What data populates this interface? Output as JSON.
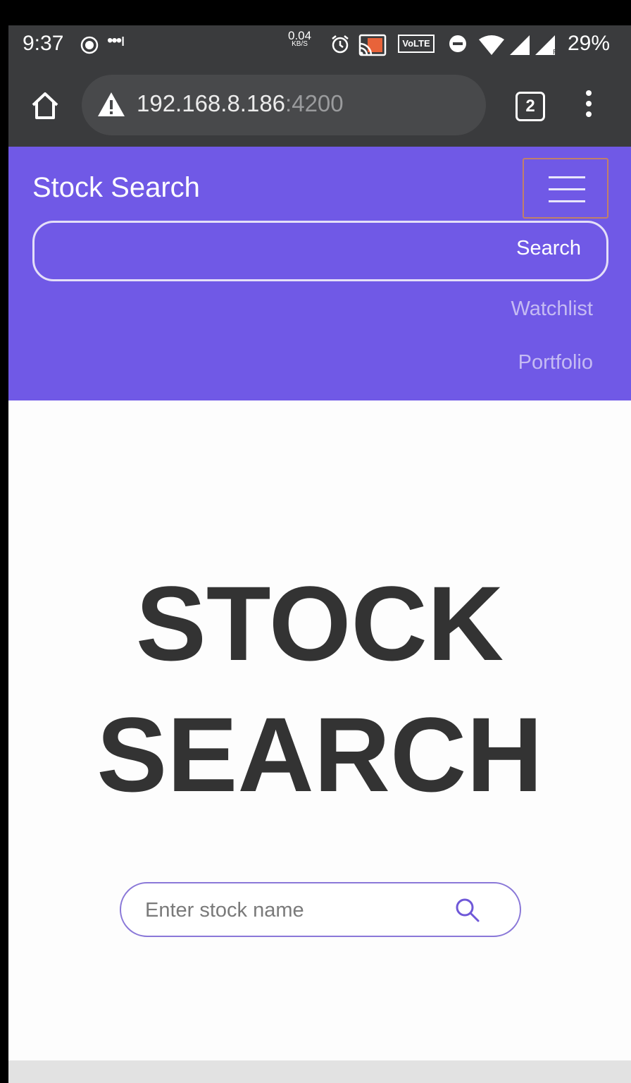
{
  "status_bar": {
    "time": "9:37",
    "signal_dots": "•••ı",
    "net_speed_value": "0.04",
    "net_speed_unit": "KB/S",
    "volte": "VoLTE",
    "battery": "29%"
  },
  "browser": {
    "url_host": "192.168.8.186",
    "url_port": ":4200",
    "tab_count": "2"
  },
  "navbar": {
    "brand": "Stock Search",
    "search_button": "Search",
    "search_value": "",
    "links": [
      "Watchlist",
      "Portfolio"
    ]
  },
  "hero": {
    "title_line1": "STOCK",
    "title_line2": "SEARCH",
    "search_placeholder": "Enter stock name"
  },
  "colors": {
    "navbar_bg": "#7059e6",
    "chrome_bg": "#3a3b3d",
    "hero_text": "#333333",
    "search_border": "#8a78d8"
  }
}
